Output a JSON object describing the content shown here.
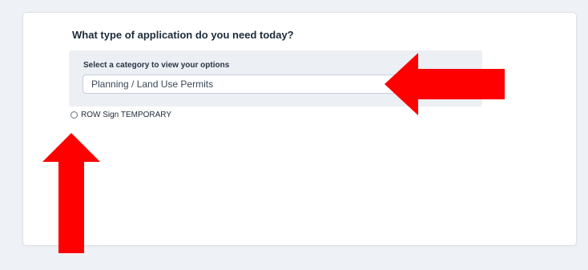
{
  "form": {
    "question": "What type of application do you need today?",
    "category_label": "Select a category to view your options",
    "selected_category": "Planning / Land Use Permits",
    "options": [
      {
        "label": "ROW Sign TEMPORARY",
        "selected": false
      }
    ]
  },
  "annotations": {
    "arrow_color": "#ff0000",
    "arrows": [
      {
        "icon": "arrow-left-icon",
        "points_to": "category-select"
      },
      {
        "icon": "arrow-up-icon",
        "points_to": "option-row-sign-temporary"
      }
    ]
  }
}
